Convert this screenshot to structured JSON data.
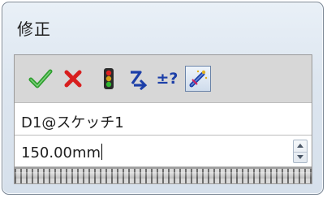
{
  "dialog": {
    "title": "修正",
    "dimension_name": "D1@スケッチ1",
    "value": "150.00mm"
  },
  "toolbar": {
    "buttons": [
      {
        "icon": "check-icon",
        "color": "#2e9e2e"
      },
      {
        "icon": "close-icon",
        "color": "#d81f1f"
      },
      {
        "icon": "rebuild-traffic-light-icon"
      },
      {
        "icon": "regenerate-arrow-icon"
      },
      {
        "icon": "plus-minus-question-icon",
        "label": "±?"
      },
      {
        "icon": "mark-dimension-icon",
        "selected": true
      }
    ]
  }
}
